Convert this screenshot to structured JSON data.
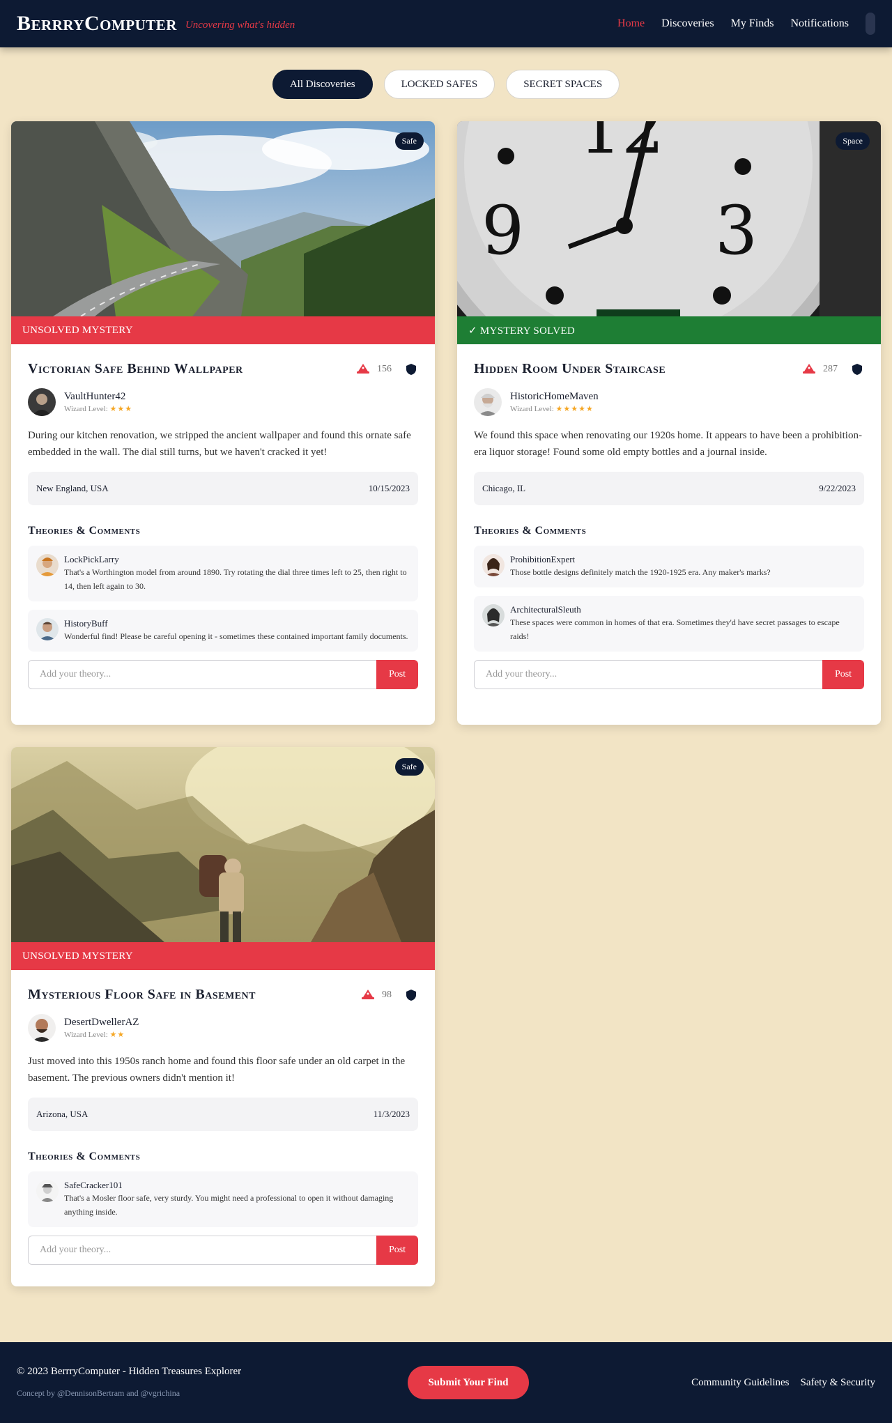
{
  "nav": {
    "brand": "BerrryComputer",
    "tagline": "Uncovering what's hidden",
    "links": [
      "Home",
      "Discoveries",
      "My Finds",
      "Notifications"
    ],
    "icon_button": "\u0000"
  },
  "filters": [
    "All Discoveries",
    " LOCKED SAFES",
    " SECRET SPACES"
  ],
  "cards": [
    {
      "badge": " Safe",
      "status": " UNSOLVED MYSTERY",
      "title": "Victorian Safe Behind Wallpaper",
      "count": "156",
      "author": "VaultHunter42",
      "wizard_label": "Wizard Level:",
      "stars": "★★★",
      "desc": "During our kitchen renovation, we stripped the ancient wallpaper and found this ornate safe embedded in the wall. The dial still turns, but we haven't cracked it yet!",
      "location": " New England, USA",
      "date": "10/15/2023",
      "section": "Theories & Comments",
      "comments": [
        {
          "name": "LockPickLarry",
          "text": "That's a Worthington model from around 1890. Try rotating the dial three times left to 25, then right to 14, then left again to 30."
        },
        {
          "name": "HistoryBuff",
          "text": "Wonderful find! Please be careful opening it - sometimes these contained important family documents."
        }
      ],
      "placeholder": "Add your theory...",
      "post": "Post"
    },
    {
      "badge": " Space",
      "status": "✓ MYSTERY SOLVED",
      "title": "Hidden Room Under Staircase",
      "count": "287",
      "author": "HistoricHomeMaven",
      "wizard_label": "Wizard Level:",
      "stars": "★★★★★",
      "desc": "We found this space when renovating our 1920s home. It appears to have been a prohibition-era liquor storage! Found some old empty bottles and a journal inside.",
      "location": " Chicago, IL",
      "date": "9/22/2023",
      "section": "Theories & Comments",
      "comments": [
        {
          "name": "ProhibitionExpert",
          "text": "Those bottle designs definitely match the 1920-1925 era. Any maker's marks?"
        },
        {
          "name": "ArchitecturalSleuth",
          "text": "These spaces were common in homes of that era. Sometimes they'd have secret passages to escape raids!"
        }
      ],
      "placeholder": "Add your theory...",
      "post": "Post"
    },
    {
      "badge": " Safe",
      "status": " UNSOLVED MYSTERY",
      "title": "Mysterious Floor Safe in Basement",
      "count": "98",
      "author": "DesertDwellerAZ",
      "wizard_label": "Wizard Level:",
      "stars": "★★",
      "desc": "Just moved into this 1950s ranch home and found this floor safe under an old carpet in the basement. The previous owners didn't mention it!",
      "location": " Arizona, USA",
      "date": "11/3/2023",
      "section": "Theories & Comments",
      "comments": [
        {
          "name": "SafeCracker101",
          "text": "That's a Mosler floor safe, very sturdy. You might need a professional to open it without damaging anything inside."
        }
      ],
      "placeholder": "Add your theory...",
      "post": "Post"
    }
  ],
  "footer": {
    "copyright": "© 2023 BerrryComputer - Hidden Treasures Explorer",
    "concept": "Concept by @DennisonBertram and @vgrichina",
    "submit": " Submit Your Find",
    "links": [
      "Community Guidelines",
      "Safety & Security"
    ]
  },
  "colors": {
    "navy": "#0d1a33",
    "accent": "#e63946",
    "solved": "#1e7e34",
    "background": "#f2e4c5",
    "stars": "#f5a623"
  }
}
